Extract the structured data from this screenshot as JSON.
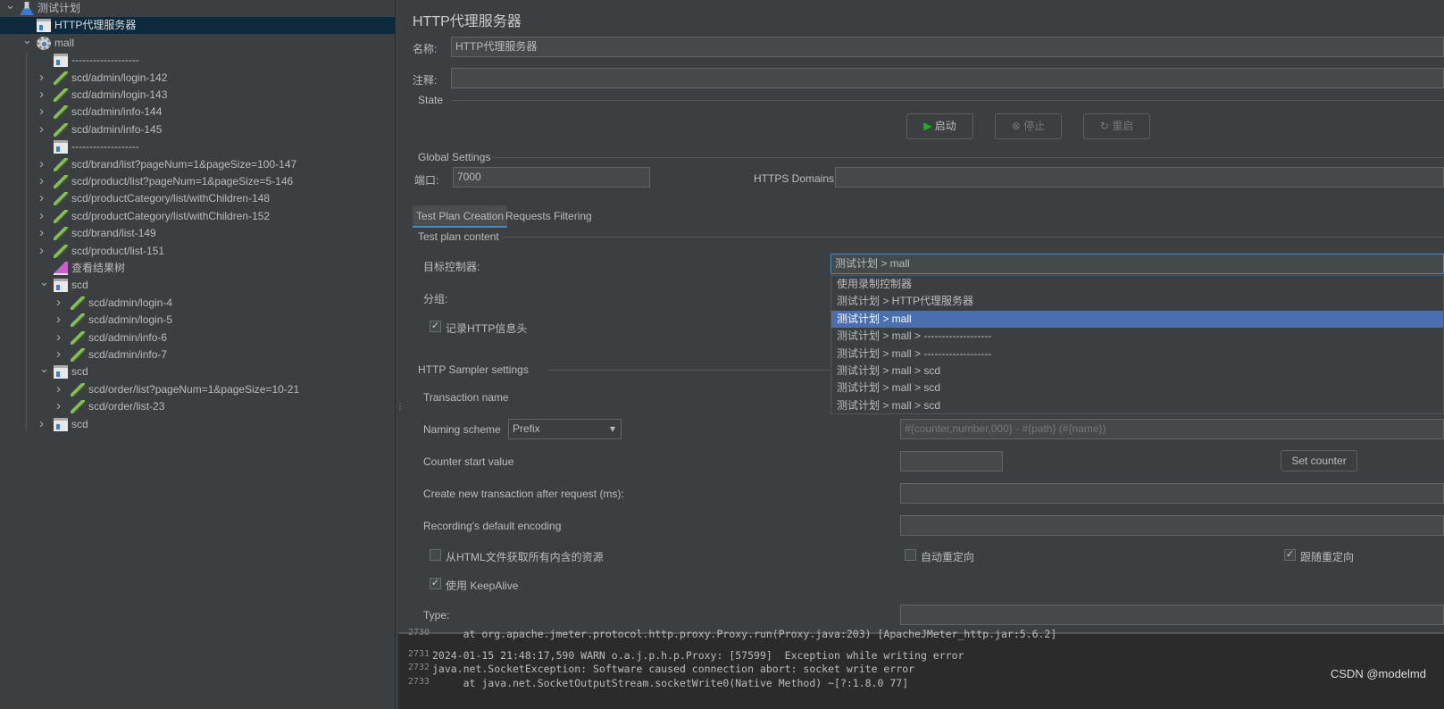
{
  "tree": [
    {
      "label": "测试计划",
      "level": 0,
      "exp": "open",
      "icon": "flask"
    },
    {
      "label": "HTTP代理服务器",
      "level": 1,
      "exp": "",
      "icon": "box",
      "selected": true
    },
    {
      "label": "mall",
      "level": 1,
      "exp": "open",
      "icon": "gear"
    },
    {
      "label": "-------------------",
      "level": 2,
      "exp": "",
      "icon": "box"
    },
    {
      "label": "scd/admin/login-142",
      "level": 2,
      "exp": "closed",
      "icon": "pip"
    },
    {
      "label": "scd/admin/login-143",
      "level": 2,
      "exp": "closed",
      "icon": "pip"
    },
    {
      "label": "scd/admin/info-144",
      "level": 2,
      "exp": "closed",
      "icon": "pip"
    },
    {
      "label": "scd/admin/info-145",
      "level": 2,
      "exp": "closed",
      "icon": "pip"
    },
    {
      "label": "-------------------",
      "level": 2,
      "exp": "",
      "icon": "box"
    },
    {
      "label": "scd/brand/list?pageNum=1&pageSize=100-147",
      "level": 2,
      "exp": "closed",
      "icon": "pip"
    },
    {
      "label": "scd/product/list?pageNum=1&pageSize=5-146",
      "level": 2,
      "exp": "closed",
      "icon": "pip"
    },
    {
      "label": "scd/productCategory/list/withChildren-148",
      "level": 2,
      "exp": "closed",
      "icon": "pip"
    },
    {
      "label": "scd/productCategory/list/withChildren-152",
      "level": 2,
      "exp": "closed",
      "icon": "pip"
    },
    {
      "label": "scd/brand/list-149",
      "level": 2,
      "exp": "closed",
      "icon": "pip"
    },
    {
      "label": "scd/product/list-151",
      "level": 2,
      "exp": "closed",
      "icon": "pip"
    },
    {
      "label": "查看结果树",
      "level": 2,
      "exp": "",
      "icon": "chart"
    },
    {
      "label": "scd",
      "level": 2,
      "exp": "open",
      "icon": "box"
    },
    {
      "label": "scd/admin/login-4",
      "level": 3,
      "exp": "closed",
      "icon": "pip"
    },
    {
      "label": "scd/admin/login-5",
      "level": 3,
      "exp": "closed",
      "icon": "pip"
    },
    {
      "label": "scd/admin/info-6",
      "level": 3,
      "exp": "closed",
      "icon": "pip"
    },
    {
      "label": "scd/admin/info-7",
      "level": 3,
      "exp": "closed",
      "icon": "pip"
    },
    {
      "label": "scd",
      "level": 2,
      "exp": "open",
      "icon": "box"
    },
    {
      "label": "scd/order/list?pageNum=1&pageSize=10-21",
      "level": 3,
      "exp": "closed",
      "icon": "pip"
    },
    {
      "label": "scd/order/list-23",
      "level": 3,
      "exp": "closed",
      "icon": "pip"
    },
    {
      "label": "scd",
      "level": 2,
      "exp": "closed",
      "icon": "box"
    }
  ],
  "main": {
    "title": "HTTP代理服务器",
    "name_label": "名称:",
    "name_value": "HTTP代理服务器",
    "comment_label": "注释:",
    "comment_value": "",
    "state_label": "State",
    "start": "启动",
    "stop": "停止",
    "restart": "重启",
    "global_label": "Global Settings",
    "port_label": "端口:",
    "port_value": "7000",
    "https_label": "HTTPS Domains:",
    "https_value": "",
    "tabs": [
      "Test Plan Creation",
      "Requests Filtering"
    ],
    "content_label": "Test plan content",
    "target_label": "目标控制器:",
    "target_value": "测试计划 > mall",
    "group_label": "分组:",
    "record_headers": "记录HTTP信息头",
    "dropdown_options": [
      "使用录制控制器",
      "测试计划 > HTTP代理服务器",
      "测试计划 > mall",
      "测试计划 > mall > -------------------",
      "测试计划 > mall > -------------------",
      "测试计划 > mall > scd",
      "测试计划 > mall > scd",
      "测试计划 > mall > scd"
    ],
    "sampler_label": "HTTP Sampler settings",
    "txn_label": "Transaction name",
    "naming_label": "Naming scheme",
    "naming_value": "Prefix",
    "naming_placeholder": "#{counter,number,000} - #{path} (#{name})",
    "counter_label": "Counter start value",
    "set_counter": "Set counter",
    "new_txn_label": "Create new transaction after request (ms):",
    "encoding_label": "Recording's default encoding",
    "fetch_resources": "从HTML文件获取所有内含的资源",
    "auto_redirect": "自动重定向",
    "follow_redirect": "跟随重定向",
    "keepalive": "使用 KeepAlive",
    "type_label": "Type:"
  },
  "log": [
    {
      "n": "2730",
      "t": "     at org.apache.jmeter.protocol.http.proxy.Proxy.run(Proxy.java:203) [ApacheJMeter_http.jar:5.6.2]"
    },
    {
      "n": "2731",
      "t": "2024-01-15 21:48:17,590 WARN o.a.j.p.h.p.Proxy: [57599]  Exception while writing error"
    },
    {
      "n": "2732",
      "t": "java.net.SocketException: Software caused connection abort: socket write error"
    },
    {
      "n": "2733",
      "t": "     at java.net.SocketOutputStream.socketWrite0(Native Method) ~[?:1.8.0 77]"
    }
  ],
  "watermark": "CSDN @modelmd"
}
